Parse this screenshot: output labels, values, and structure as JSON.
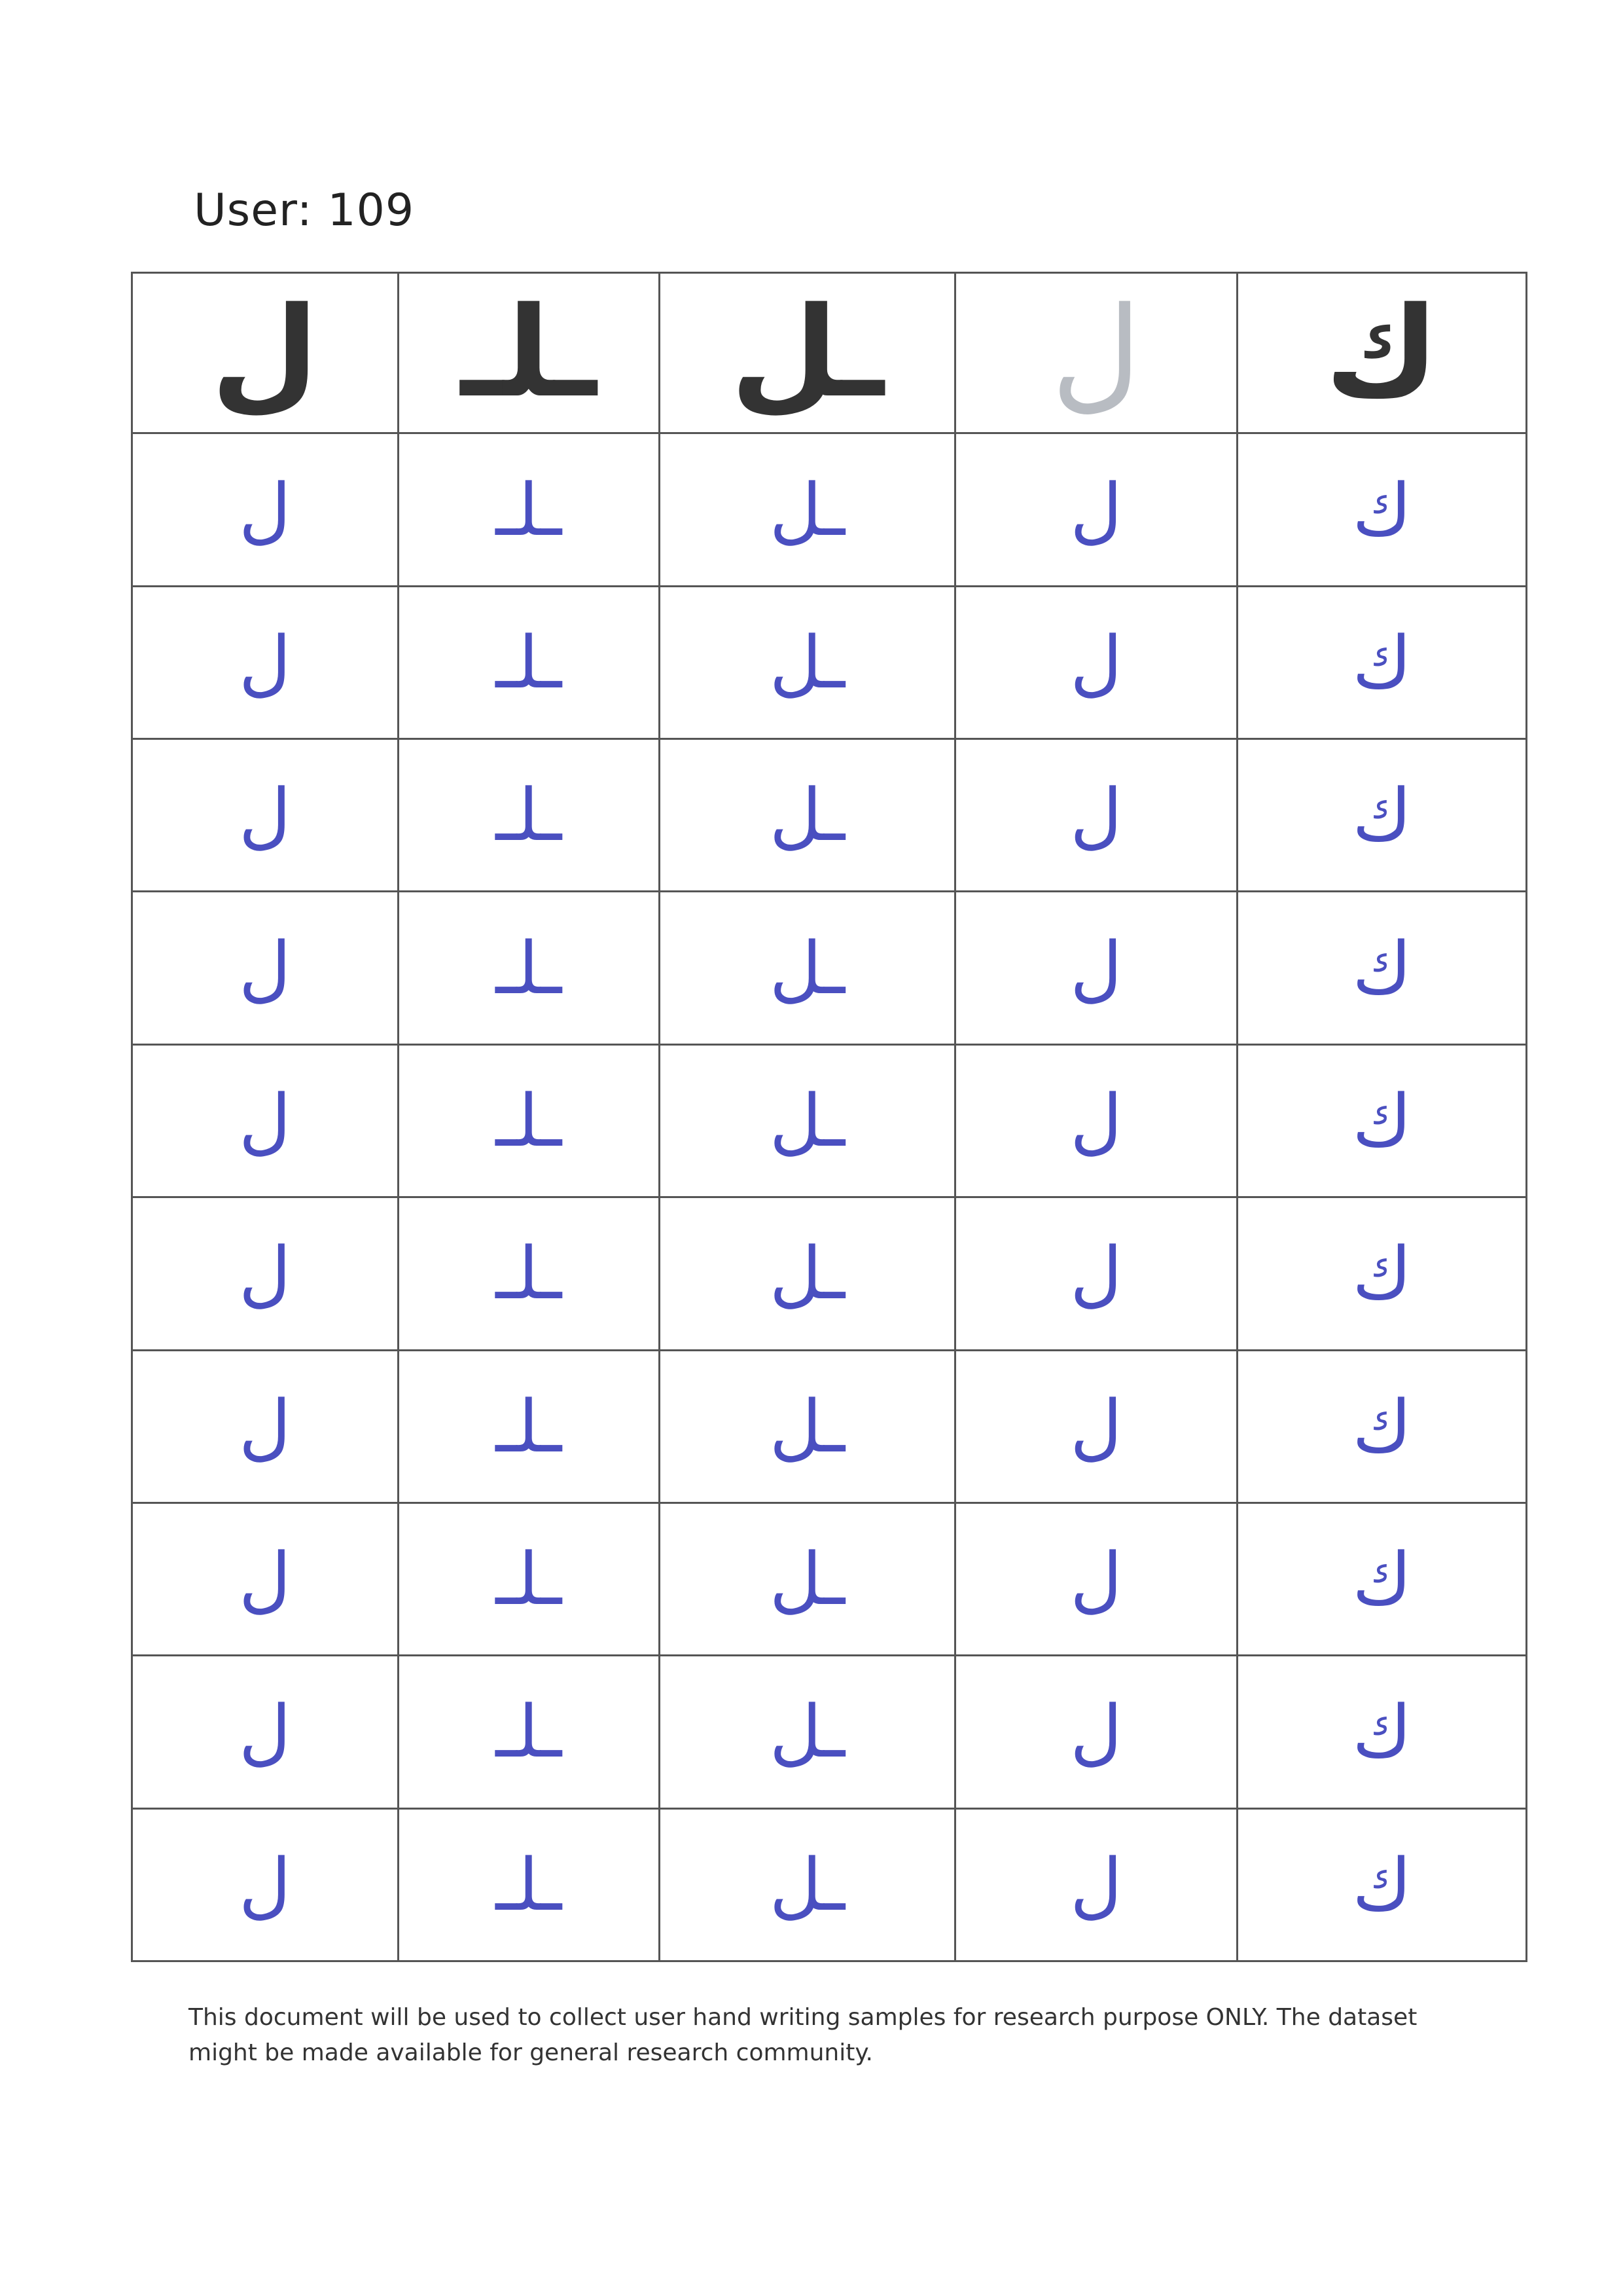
{
  "header": {
    "user_label": "User: 109"
  },
  "grid": {
    "reference_row": [
      "ل",
      "ـلـ",
      "ـل",
      "ل",
      "ك"
    ],
    "sample_rows": [
      [
        "ل",
        "ـلـ",
        "ـل",
        "ل",
        "ك"
      ],
      [
        "ل",
        "ـلـ",
        "ـل",
        "ل",
        "ك"
      ],
      [
        "ل",
        "ـلـ",
        "ـل",
        "ل",
        "ك"
      ],
      [
        "ل",
        "ـلـ",
        "ـل",
        "ل",
        "ك"
      ],
      [
        "ل",
        "ـلـ",
        "ـل",
        "ل",
        "ك"
      ],
      [
        "ل",
        "ـلـ",
        "ـل",
        "ل",
        "ك"
      ],
      [
        "ل",
        "ـلـ",
        "ـل",
        "ل",
        "ك"
      ],
      [
        "ل",
        "ـلـ",
        "ـل",
        "ل",
        "ك"
      ],
      [
        "ل",
        "ـلـ",
        "ـل",
        "ل",
        "ك"
      ],
      [
        "ل",
        "ـلـ",
        "ـل",
        "ل",
        "ك"
      ]
    ],
    "reference_color": "#333333",
    "faded_reference_color": "#b8bcc2",
    "handwriting_color": "#4a4fc0"
  },
  "footer": {
    "note": "This document will be used to collect user hand writing samples for research purpose ONLY. The dataset might be made available for general research community."
  }
}
